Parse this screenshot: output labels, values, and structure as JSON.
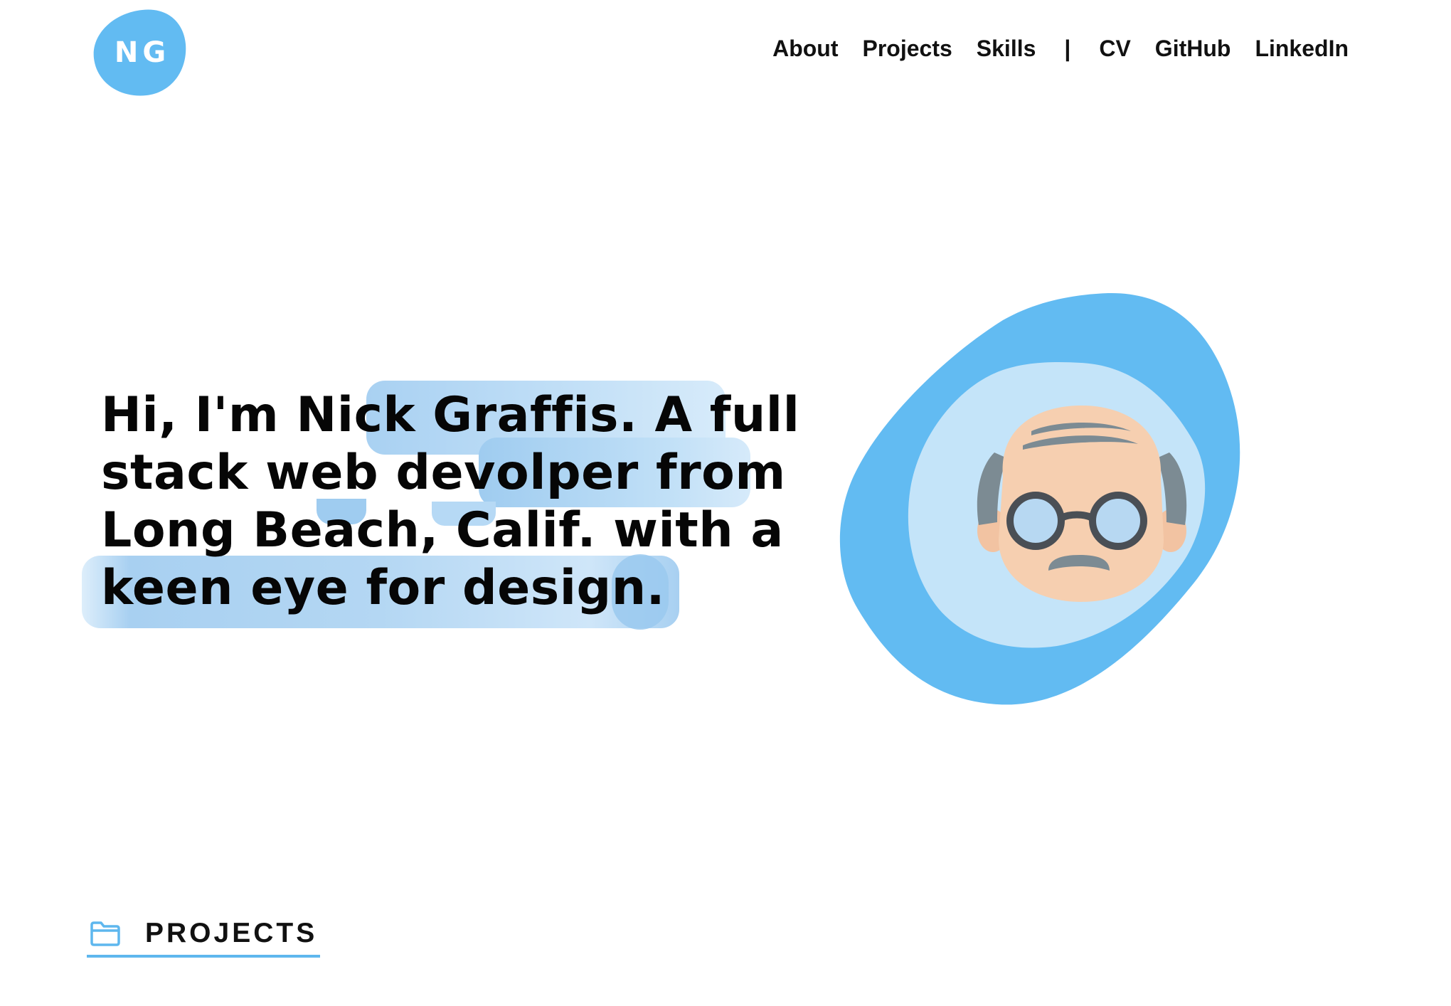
{
  "brand": {
    "logo_text": "NG",
    "accent": "#62bbf2"
  },
  "nav": {
    "items": [
      "About",
      "Projects",
      "Skills",
      "CV",
      "GitHub",
      "LinkedIn"
    ],
    "separator": "|"
  },
  "hero": {
    "lines": [
      "Hi, I'm Nick Graffis. A full",
      "stack web devolper from",
      "Long Beach, Calif. with a",
      "keen eye for design."
    ],
    "highlight_color": "#a9d1f2"
  },
  "avatar": {
    "icon": "bald-man-with-glasses-avatar",
    "outer_color": "#62bbf2",
    "inner_color": "#c4e4f9",
    "skin_color": "#f6cfb0",
    "hair_color": "#7c8b93"
  },
  "projects_section": {
    "icon": "folder-icon",
    "title": "PROJECTS"
  }
}
